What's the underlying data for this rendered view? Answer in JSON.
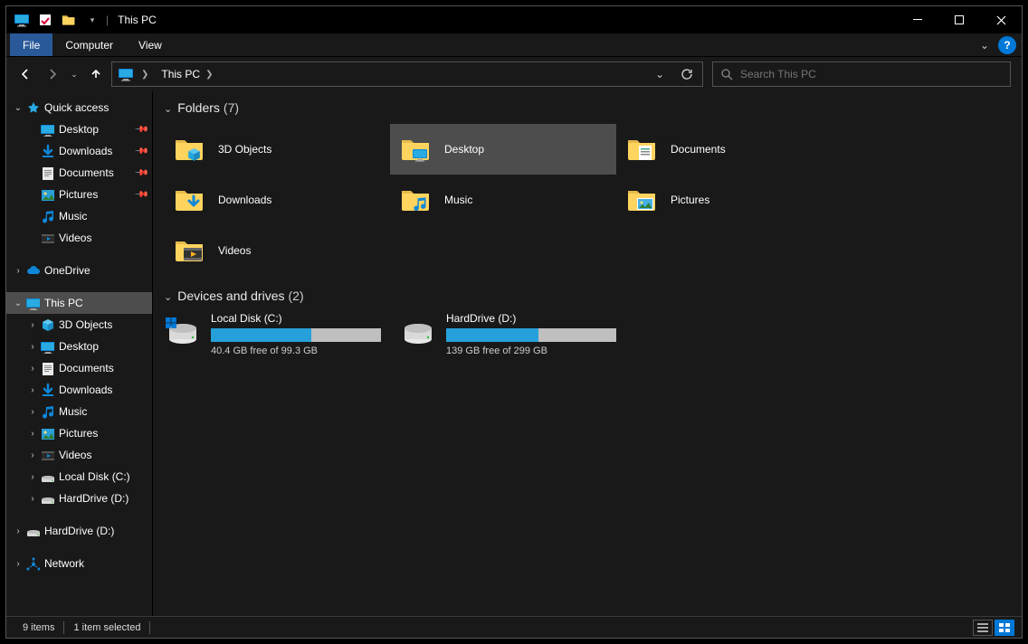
{
  "titlebar": {
    "title": "This PC"
  },
  "ribbon": {
    "file": "File",
    "tabs": [
      "Computer",
      "View"
    ]
  },
  "address": {
    "location": "This PC"
  },
  "search": {
    "placeholder": "Search This PC"
  },
  "sidebar": {
    "quick_access": {
      "label": "Quick access",
      "items": [
        {
          "label": "Desktop",
          "icon": "desktop",
          "pinned": true
        },
        {
          "label": "Downloads",
          "icon": "downloads",
          "pinned": true
        },
        {
          "label": "Documents",
          "icon": "documents",
          "pinned": true
        },
        {
          "label": "Pictures",
          "icon": "pictures",
          "pinned": true
        },
        {
          "label": "Music",
          "icon": "music",
          "pinned": false
        },
        {
          "label": "Videos",
          "icon": "videos",
          "pinned": false
        }
      ]
    },
    "onedrive": {
      "label": "OneDrive"
    },
    "this_pc": {
      "label": "This PC",
      "items": [
        {
          "label": "3D Objects",
          "icon": "3d"
        },
        {
          "label": "Desktop",
          "icon": "desktop"
        },
        {
          "label": "Documents",
          "icon": "documents"
        },
        {
          "label": "Downloads",
          "icon": "downloads"
        },
        {
          "label": "Music",
          "icon": "music"
        },
        {
          "label": "Pictures",
          "icon": "pictures"
        },
        {
          "label": "Videos",
          "icon": "videos"
        },
        {
          "label": "Local Disk (C:)",
          "icon": "drive"
        },
        {
          "label": "HardDrive (D:)",
          "icon": "drive"
        }
      ]
    },
    "harddrive": {
      "label": "HardDrive (D:)"
    },
    "network": {
      "label": "Network"
    }
  },
  "main": {
    "folders": {
      "header": "Folders",
      "count": "(7)",
      "items": [
        {
          "label": "3D Objects",
          "icon": "3d",
          "selected": false
        },
        {
          "label": "Desktop",
          "icon": "desktop-folder",
          "selected": true
        },
        {
          "label": "Documents",
          "icon": "documents-folder",
          "selected": false
        },
        {
          "label": "Downloads",
          "icon": "downloads-folder",
          "selected": false
        },
        {
          "label": "Music",
          "icon": "music-folder",
          "selected": false
        },
        {
          "label": "Pictures",
          "icon": "pictures-folder",
          "selected": false
        },
        {
          "label": "Videos",
          "icon": "videos-folder",
          "selected": false
        }
      ]
    },
    "drives": {
      "header": "Devices and drives",
      "count": "(2)",
      "items": [
        {
          "label": "Local Disk (C:)",
          "free_text": "40.4 GB free of 99.3 GB",
          "used_pct": 59,
          "icon": "osdisk"
        },
        {
          "label": "HardDrive (D:)",
          "free_text": "139 GB free of 299 GB",
          "used_pct": 54,
          "icon": "hdd"
        }
      ]
    }
  },
  "statusbar": {
    "count": "9 items",
    "selection": "1 item selected"
  }
}
